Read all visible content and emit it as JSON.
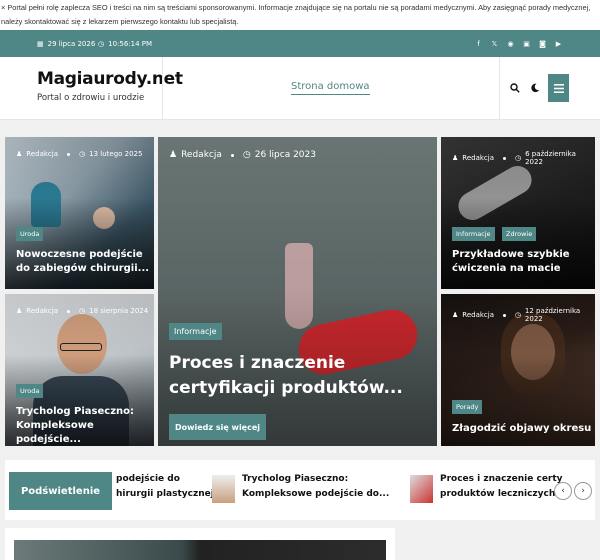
{
  "notice": "× Portal pełni rolę zaplecza SEO i treści na nim są treściami sponsorowanymi. Informacje znajdujące się na portalu nie są poradami medycznymi. Aby zasięgnąć porady medycznej, należy skontaktować się z lekarzem pierwszego kontaktu lub specjalistą.",
  "topbar": {
    "date": "29 lipca 2026",
    "time": "10:56:14 PM",
    "social": [
      "f",
      "𝕏",
      "◉",
      "▣",
      "◙",
      "▶"
    ]
  },
  "header": {
    "site_title": "Magiaurody.net",
    "tagline": "Portal o zdrowiu i urodzie",
    "nav_home": "Strona domowa"
  },
  "posts": {
    "p1": {
      "author": "Redakcja",
      "date": "13 lutego 2025",
      "tag": "Uroda",
      "title": "Nowoczesne podejście do zabiegów chirurgii..."
    },
    "p2": {
      "author": "Redakcja",
      "date": "18 sierpnia 2024",
      "tag": "Uroda",
      "title": "Trycholog Piaseczno: Kompleksowe podejście..."
    },
    "main": {
      "author": "Redakcja",
      "date": "26 lipca 2023",
      "tag": "Informacje",
      "title": "Proces i znaczenie certyfikacji produktów...",
      "button": "Dowiedz się więcej"
    },
    "p3": {
      "author": "Redakcja",
      "date": "6 października 2022",
      "tag": "Informacje",
      "tag2": "Zdrowie",
      "title": "Przykładowe szybkie ćwiczenia na macie"
    },
    "p4": {
      "author": "Redakcja",
      "date": "12 października 2022",
      "tag": "Porady",
      "title": "Złagodzić objawy okresu"
    }
  },
  "highlight": {
    "label": "Podświetlenie",
    "frag_line1": "podejście do",
    "frag_line2": "hirurgii plastycznej –...",
    "item1_line1": "Trycholog Piaseczno:",
    "item1_line2": "Kompleksowe podejście do...",
    "item2_line1": "Proces i znaczenie certy",
    "item2_line2": "produktów leczniczych"
  },
  "colors": {
    "accent": "#4f8686"
  }
}
